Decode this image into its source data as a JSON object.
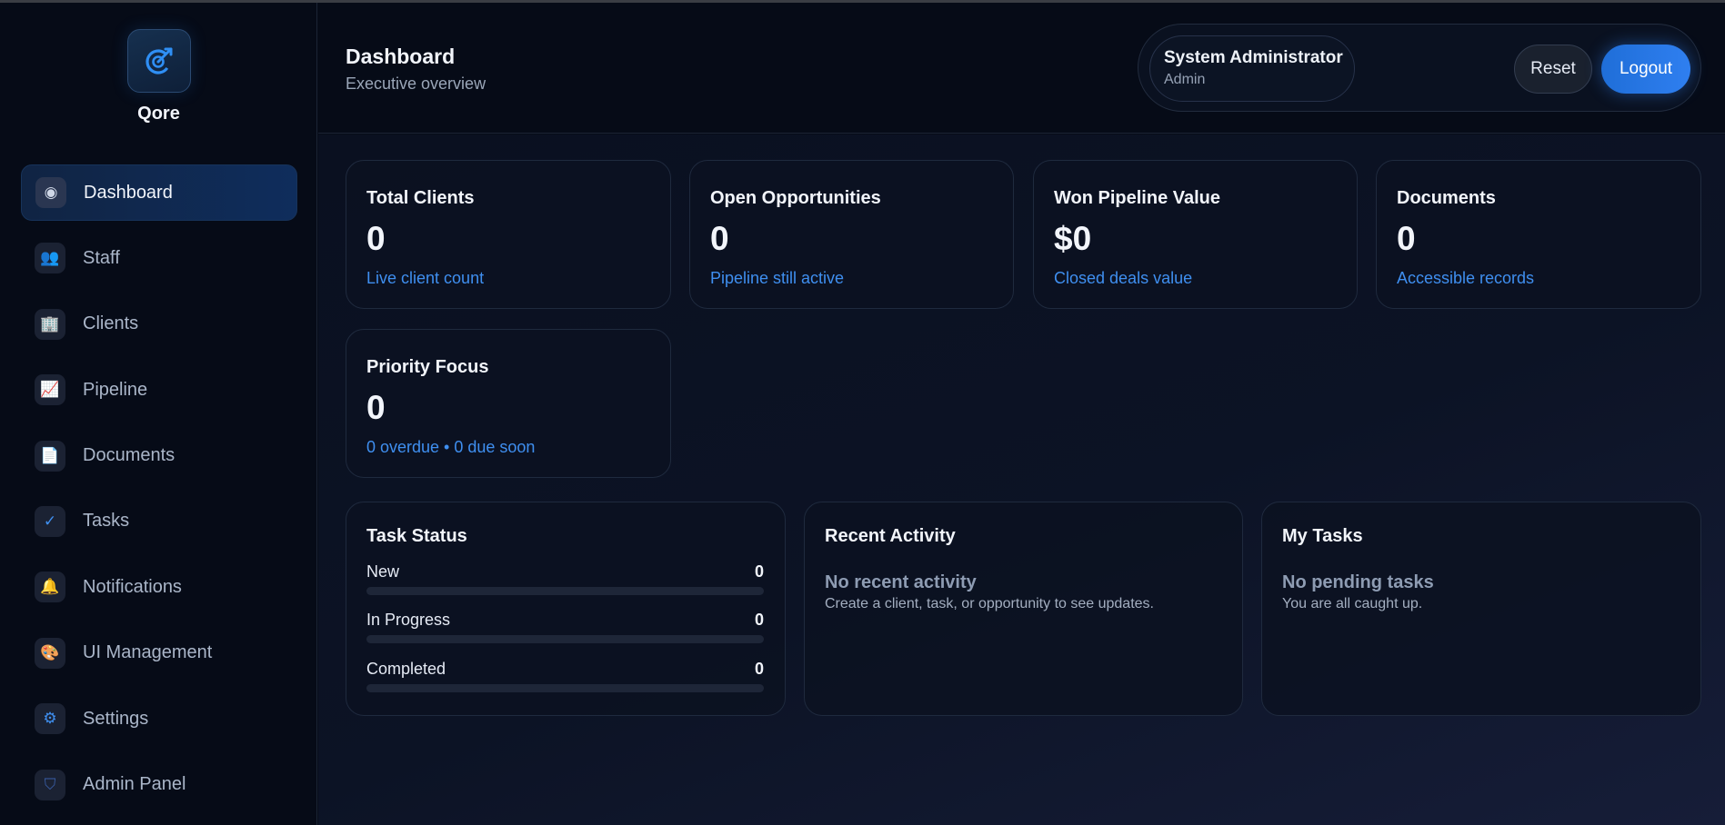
{
  "app": {
    "name": "Qore"
  },
  "sidebar": {
    "items": [
      {
        "label": "Dashboard",
        "icon": "radio-dot-icon",
        "glyph": "◉",
        "active": true
      },
      {
        "label": "Staff",
        "icon": "people-icon",
        "glyph": "👥",
        "active": false
      },
      {
        "label": "Clients",
        "icon": "building-icon",
        "glyph": "🏢",
        "active": false
      },
      {
        "label": "Pipeline",
        "icon": "chart-up-icon",
        "glyph": "📈",
        "active": false
      },
      {
        "label": "Documents",
        "icon": "document-icon",
        "glyph": "📄",
        "active": false
      },
      {
        "label": "Tasks",
        "icon": "check-icon",
        "glyph": "✓",
        "active": false
      },
      {
        "label": "Notifications",
        "icon": "bell-icon",
        "glyph": "🔔",
        "active": false
      },
      {
        "label": "UI Management",
        "icon": "palette-icon",
        "glyph": "🎨",
        "active": false
      },
      {
        "label": "Settings",
        "icon": "gear-icon",
        "glyph": "⚙",
        "active": false
      },
      {
        "label": "Admin Panel",
        "icon": "shield-icon",
        "glyph": "⛉",
        "active": false
      }
    ]
  },
  "header": {
    "title": "Dashboard",
    "subtitle": "Executive overview",
    "user_name": "System Administrator",
    "user_role": "Admin",
    "reset_label": "Reset",
    "logout_label": "Logout"
  },
  "stats": [
    {
      "title": "Total Clients",
      "value": "0",
      "sub": "Live client count"
    },
    {
      "title": "Open Opportunities",
      "value": "0",
      "sub": "Pipeline still active"
    },
    {
      "title": "Won Pipeline Value",
      "value": "$0",
      "sub": "Closed deals value"
    },
    {
      "title": "Documents",
      "value": "0",
      "sub": "Accessible records"
    },
    {
      "title": "Priority Focus",
      "value": "0",
      "sub": "0 overdue • 0 due soon"
    }
  ],
  "task_status": {
    "title": "Task Status",
    "rows": [
      {
        "label": "New",
        "count": "0",
        "progress": 0
      },
      {
        "label": "In Progress",
        "count": "0",
        "progress": 0
      },
      {
        "label": "Completed",
        "count": "0",
        "progress": 0
      }
    ]
  },
  "recent_activity": {
    "title": "Recent Activity",
    "empty_title": "No recent activity",
    "empty_sub": "Create a client, task, or opportunity to see updates."
  },
  "my_tasks": {
    "title": "My Tasks",
    "empty_title": "No pending tasks",
    "empty_sub": "You are all caught up."
  },
  "colors": {
    "accent": "#2f7ff0",
    "accent_text": "#3f8ff0",
    "background": "#070c18",
    "card_border": "#1f2a3e"
  }
}
